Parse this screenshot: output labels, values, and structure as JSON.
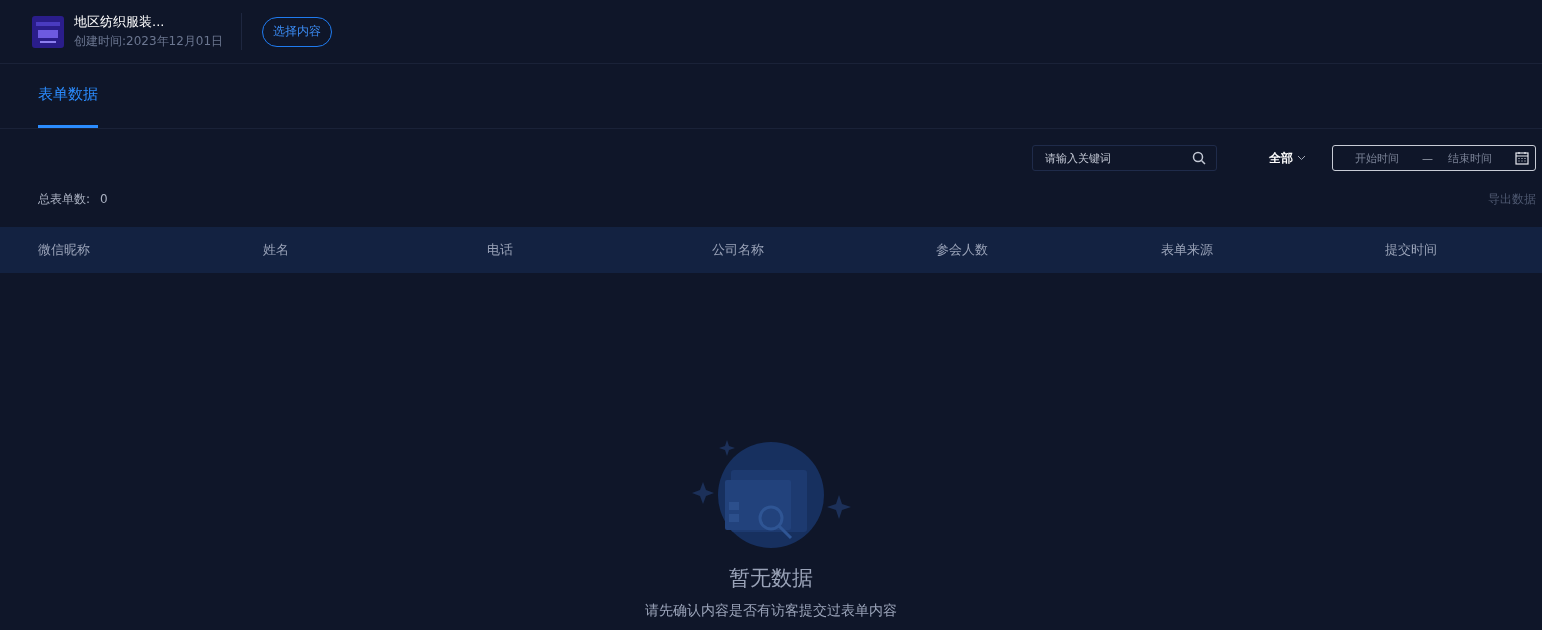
{
  "header": {
    "title": "地区纺织服装...",
    "created": "创建时间:2023年12月01日",
    "select_button": "选择内容"
  },
  "tabs": [
    {
      "label": "表单数据",
      "selected": true
    }
  ],
  "filters": {
    "search": {
      "placeholder": "请输入关键词"
    },
    "scope": "全部",
    "date_range": {
      "start_placeholder": "开始时间",
      "separator": "—",
      "end_placeholder": "结束时间"
    }
  },
  "summary": {
    "label": "总表单数:",
    "count": "0",
    "export": "导出数据"
  },
  "table": {
    "columns": [
      "微信昵称",
      "姓名",
      "电话",
      "公司名称",
      "参会人数",
      "表单来源",
      "提交时间"
    ]
  },
  "empty_state": {
    "title": "暂无数据",
    "message": "请先确认内容是否有访客提交过表单内容"
  }
}
